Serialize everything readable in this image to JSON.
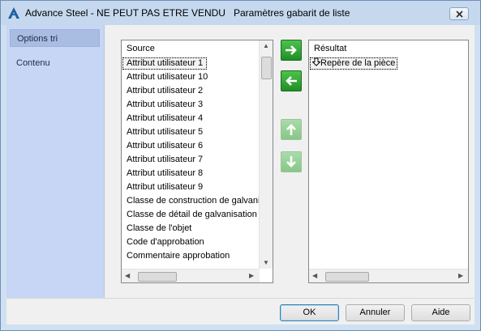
{
  "window": {
    "title_app": "Advance Steel - NE PEUT PAS ETRE VENDU",
    "title_dialog": "Paramètres gabarit de liste",
    "app_icon": "autodesk-a-icon",
    "close_icon": "close-icon"
  },
  "sidebar": {
    "items": [
      {
        "label": "Options tri",
        "selected": true
      },
      {
        "label": "Contenu",
        "selected": false
      }
    ]
  },
  "source": {
    "header": "Source",
    "items": [
      "Attribut utilisateur 1",
      "Attribut utilisateur 10",
      "Attribut utilisateur 2",
      "Attribut utilisateur 3",
      "Attribut utilisateur 4",
      "Attribut utilisateur 5",
      "Attribut utilisateur 6",
      "Attribut utilisateur 7",
      "Attribut utilisateur 8",
      "Attribut utilisateur 9",
      "Classe de construction de galvanisation",
      "Classe de détail de galvanisation",
      "Classe de l'objet",
      "Code d'approbation",
      "Commentaire approbation"
    ]
  },
  "result": {
    "header": "Résultat",
    "items": [
      {
        "label": "Repère de la pièce",
        "sort_icon": "arrow-down-outline-icon"
      }
    ]
  },
  "transfer_buttons": [
    {
      "name": "add-to-result",
      "icon": "arrow-right-icon",
      "enabled": true
    },
    {
      "name": "remove-from-result",
      "icon": "arrow-left-icon",
      "enabled": true
    },
    {
      "name": "move-up",
      "icon": "arrow-up-icon",
      "enabled": false
    },
    {
      "name": "move-down",
      "icon": "arrow-down-icon",
      "enabled": false
    }
  ],
  "footer": {
    "ok_label": "OK",
    "cancel_label": "Annuler",
    "help_label": "Aide"
  },
  "colors": {
    "titlebar": "#c5d8ee",
    "sidebar": "#c6d6f4",
    "sidebar_selected": "#a9bde3",
    "arrow_enabled": "#2ea836",
    "arrow_disabled": "#9dd29d"
  }
}
